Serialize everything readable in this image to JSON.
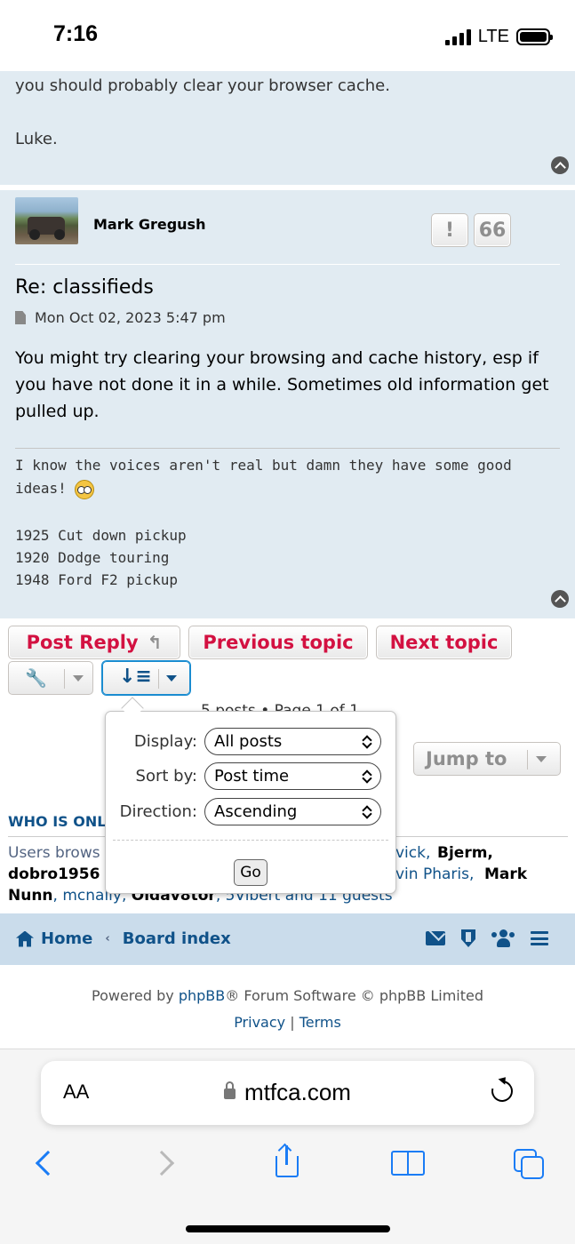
{
  "status_bar": {
    "time": "7:16",
    "network": "LTE"
  },
  "previous_post": {
    "lines": [
      "you should probably clear your browser cache.",
      "Luke."
    ]
  },
  "post": {
    "author": "Mark Gregush",
    "report_label": "!",
    "quote_label": "66",
    "title": "Re: classifieds",
    "date": "Mon Oct 02, 2023 5:47 pm",
    "body": [
      "You might try clearing your browsing and cache history, esp if",
      "you have not done it in a while. Sometimes old information get",
      "pulled up."
    ],
    "signature_line1": "I know the voices aren't real but damn they have some good",
    "signature_line2": "ideas!",
    "signature_emoji": "eyes-emoji",
    "cars": [
      "1925 Cut down pickup",
      "1920 Dodge touring",
      "1948 Ford F2 pickup"
    ]
  },
  "actions": {
    "post_reply": "Post Reply",
    "previous_topic": "Previous topic",
    "next_topic": "Next topic",
    "jump_to": "Jump to",
    "pagination_partial": "5 posts • Page 1 of 1"
  },
  "sort_popup": {
    "display_label": "Display:",
    "display_value": "All posts",
    "sort_label": "Sort by:",
    "sort_value": "Post time",
    "direction_label": "Direction:",
    "direction_value": "Ascending",
    "go_label": "Go"
  },
  "who_is_online": {
    "title": "WHO IS ONLINE",
    "text_visible_start": "Users brows",
    "line1_right": "vick,",
    "line1_bold": "Bjerm,",
    "line2_left": "dobro1956",
    "line2_mid": "vin Pharis,",
    "line2_bold": "Mark",
    "line3_bold1": "Nunn",
    "line3_text1": ", mcnally, ",
    "line3_bold2": "Oldav8tor",
    "line3_text2": ", 5Vibert and 11 guests"
  },
  "navbar": {
    "home": "Home",
    "board_index": "Board index"
  },
  "footer": {
    "powered_by": "Powered by ",
    "phpbb": "phpBB",
    "rest": "® Forum Software © phpBB Limited",
    "privacy": "Privacy",
    "separator": " | ",
    "terms": "Terms"
  },
  "browser": {
    "aa_label": "AA",
    "url": "mtfca.com"
  },
  "colors": {
    "post_bg": "#e1ebf2",
    "link_blue": "#105289",
    "button_red": "#d31141",
    "navbar_bg": "#cadceb",
    "ios_blue": "#1a7cf5"
  }
}
